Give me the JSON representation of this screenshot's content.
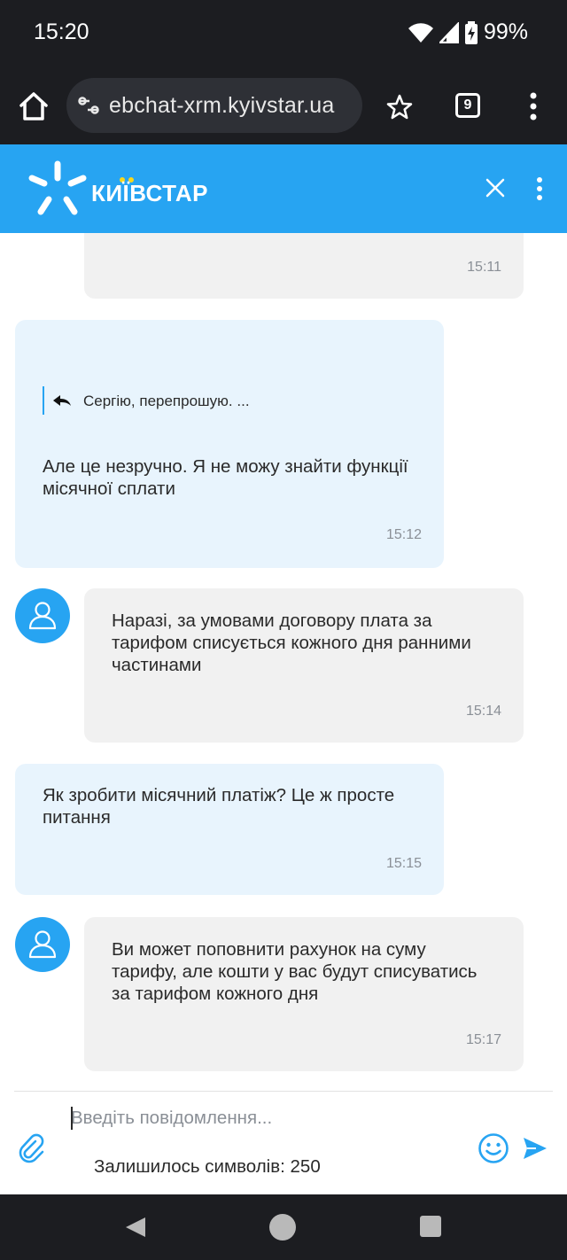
{
  "status_bar": {
    "time": "15:20",
    "battery": "99%"
  },
  "browser": {
    "url": "ebchat-xrm.kyivstar.ua",
    "tab_count": "9"
  },
  "chat_header": {
    "brand": "КИЇВСТАР",
    "accent_color": "#27a4f2"
  },
  "messages": [
    {
      "from": "operator",
      "text": "",
      "time": "15:11"
    },
    {
      "from": "user",
      "quote": "Сергію, перепрошую. ...",
      "text": "Але це незручно. Я не можу знайти функції місячної сплати",
      "time": "15:12"
    },
    {
      "from": "operator",
      "text": "Наразі, за умовами договору плата за тарифом списується кожного дня ранними частинами",
      "time": "15:14"
    },
    {
      "from": "user",
      "text": "Як зробити місячний платіж? Це ж просте питання",
      "time": "15:15"
    },
    {
      "from": "operator",
      "text": "Ви может поповнити рахунок на суму тарифу, але кошти у вас будут списуватись за тарифом кожного дня",
      "time": "15:17"
    }
  ],
  "composer": {
    "placeholder": "Введіть повідомлення...",
    "value": "",
    "chars_left_label": "Залишилось символів: 250"
  }
}
